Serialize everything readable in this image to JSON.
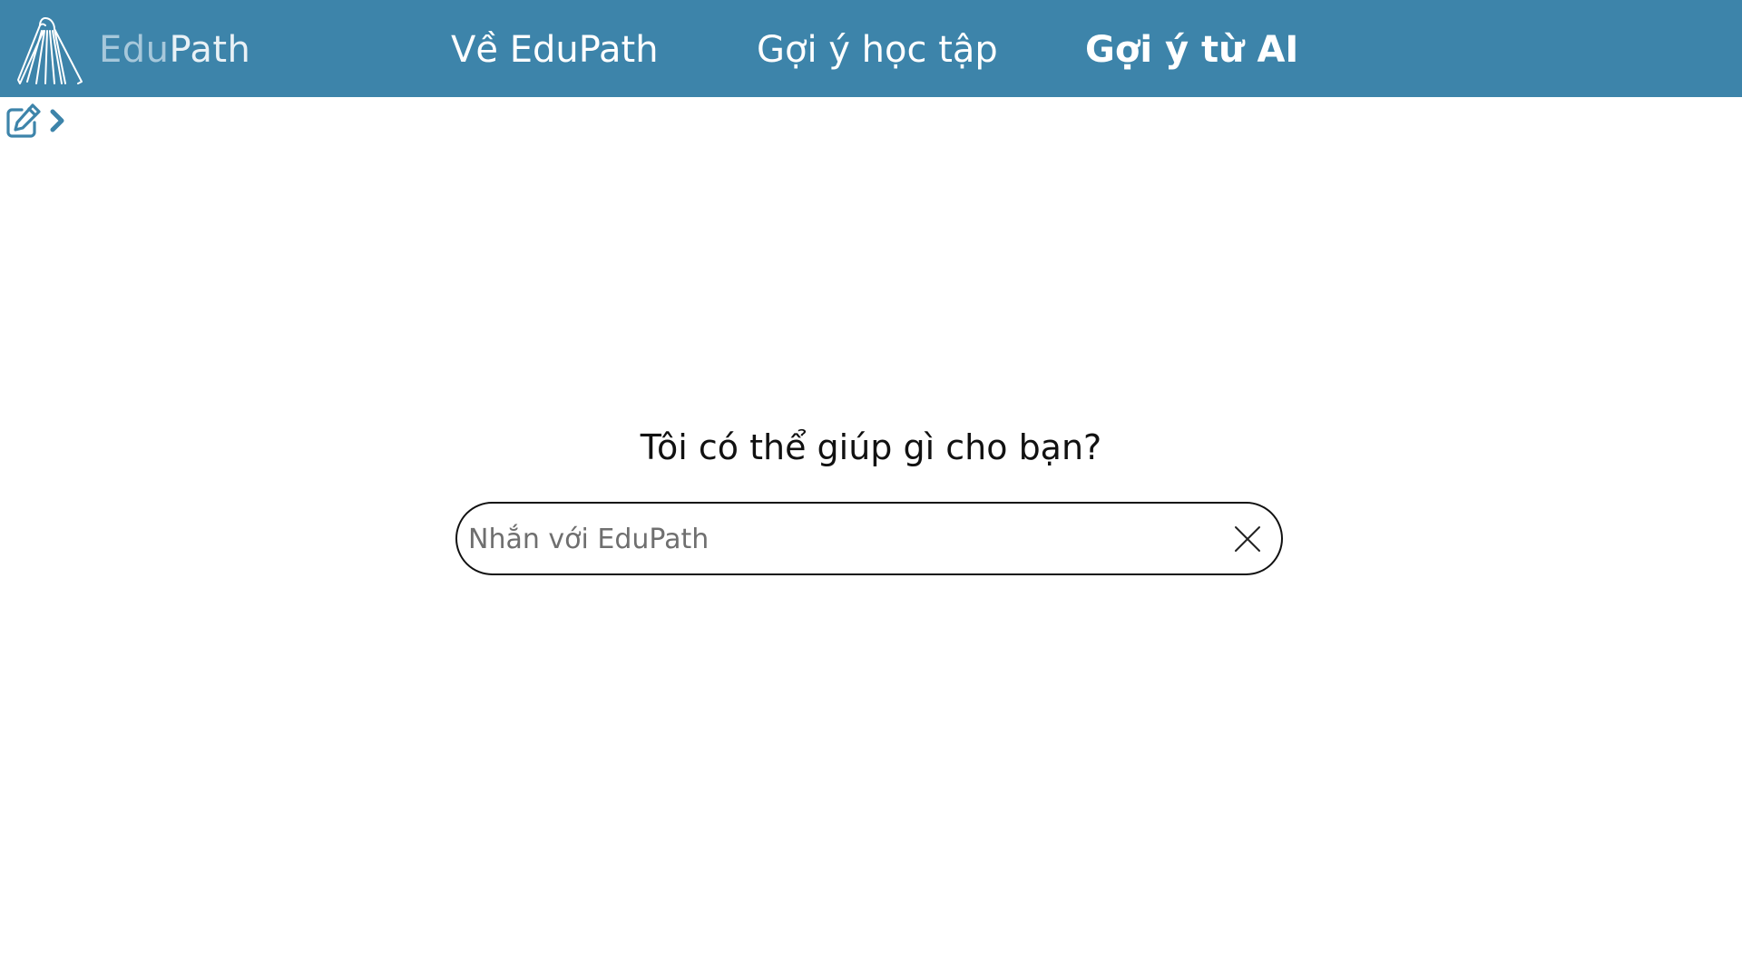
{
  "header": {
    "brand_part1": "Edu",
    "brand_part2": "Path",
    "nav": [
      {
        "label": "Về EduPath"
      },
      {
        "label": "Gợi ý học tập"
      },
      {
        "label": "Gợi ý từ AI",
        "active": true
      }
    ],
    "background_color": "#3d84aa",
    "logo_icon": "book-icon"
  },
  "toolbar": {
    "icons": [
      "edit-icon",
      "chevron-right-icon"
    ],
    "icon_color": "#3d84aa"
  },
  "main": {
    "heading": "Tôi có thể giúp gì cho bạn?",
    "chat_input": {
      "placeholder": "Nhắn với EduPath",
      "value": ""
    },
    "clear_icon": "close-icon"
  }
}
